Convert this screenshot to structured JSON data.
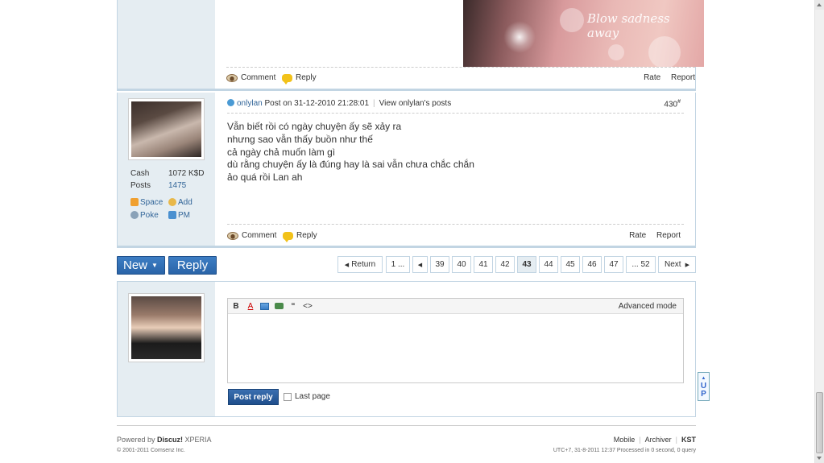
{
  "post1": {
    "banner_text": "Blow sadness away",
    "actions": {
      "comment": "Comment",
      "reply": "Reply",
      "rate": "Rate",
      "report": "Report"
    }
  },
  "post2": {
    "author": {
      "name": "onlylan",
      "cash_label": "Cash",
      "cash_value": "1072 K$D",
      "posts_label": "Posts",
      "posts_value": "1475",
      "links": {
        "space": "Space",
        "add": "Add",
        "poke": "Poke",
        "pm": "PM"
      }
    },
    "meta": {
      "post_on": "Post on 31-12-2010 21:28:01",
      "view_posts": "View onlylan's posts",
      "floor": "430",
      "floor_suffix": "#"
    },
    "lines": [
      "Vẫn biết rồi có ngày chuyện ấy sẽ xảy ra",
      "nhưng sao vẫn thấy buồn như thế",
      "cả ngày chả muốn làm gì",
      "dù rằng chuyện ấy là đúng hay là sai vẫn chưa chắc chắn",
      "ảo quá rồi Lan ah"
    ],
    "actions": {
      "comment": "Comment",
      "reply": "Reply",
      "rate": "Rate",
      "report": "Report"
    }
  },
  "toolbar": {
    "new_label": "New",
    "reply_label": "Reply"
  },
  "pager": {
    "return": "Return",
    "first": "1 ...",
    "pages": [
      "39",
      "40",
      "41",
      "42",
      "43",
      "44",
      "45",
      "46",
      "47"
    ],
    "current": "43",
    "last": "... 52",
    "next": "Next"
  },
  "reply_form": {
    "advanced_mode": "Advanced mode",
    "post_reply": "Post reply",
    "last_page": "Last page",
    "tools": [
      "B",
      "A",
      "image",
      "link",
      "“",
      "<>"
    ]
  },
  "footer": {
    "powered_prefix": "Powered by ",
    "powered_brand": "Discuz!",
    "powered_suffix": " XPERIA",
    "copyright": "© 2001-2011 Comsenz Inc.",
    "mobile": "Mobile",
    "archiver": "Archiver",
    "kst": "KST",
    "time": "UTC+7, 31-8-2011 12:37 Processed in 0 second, 0 query"
  },
  "up_button": {
    "line1": "U",
    "line2": "P"
  }
}
